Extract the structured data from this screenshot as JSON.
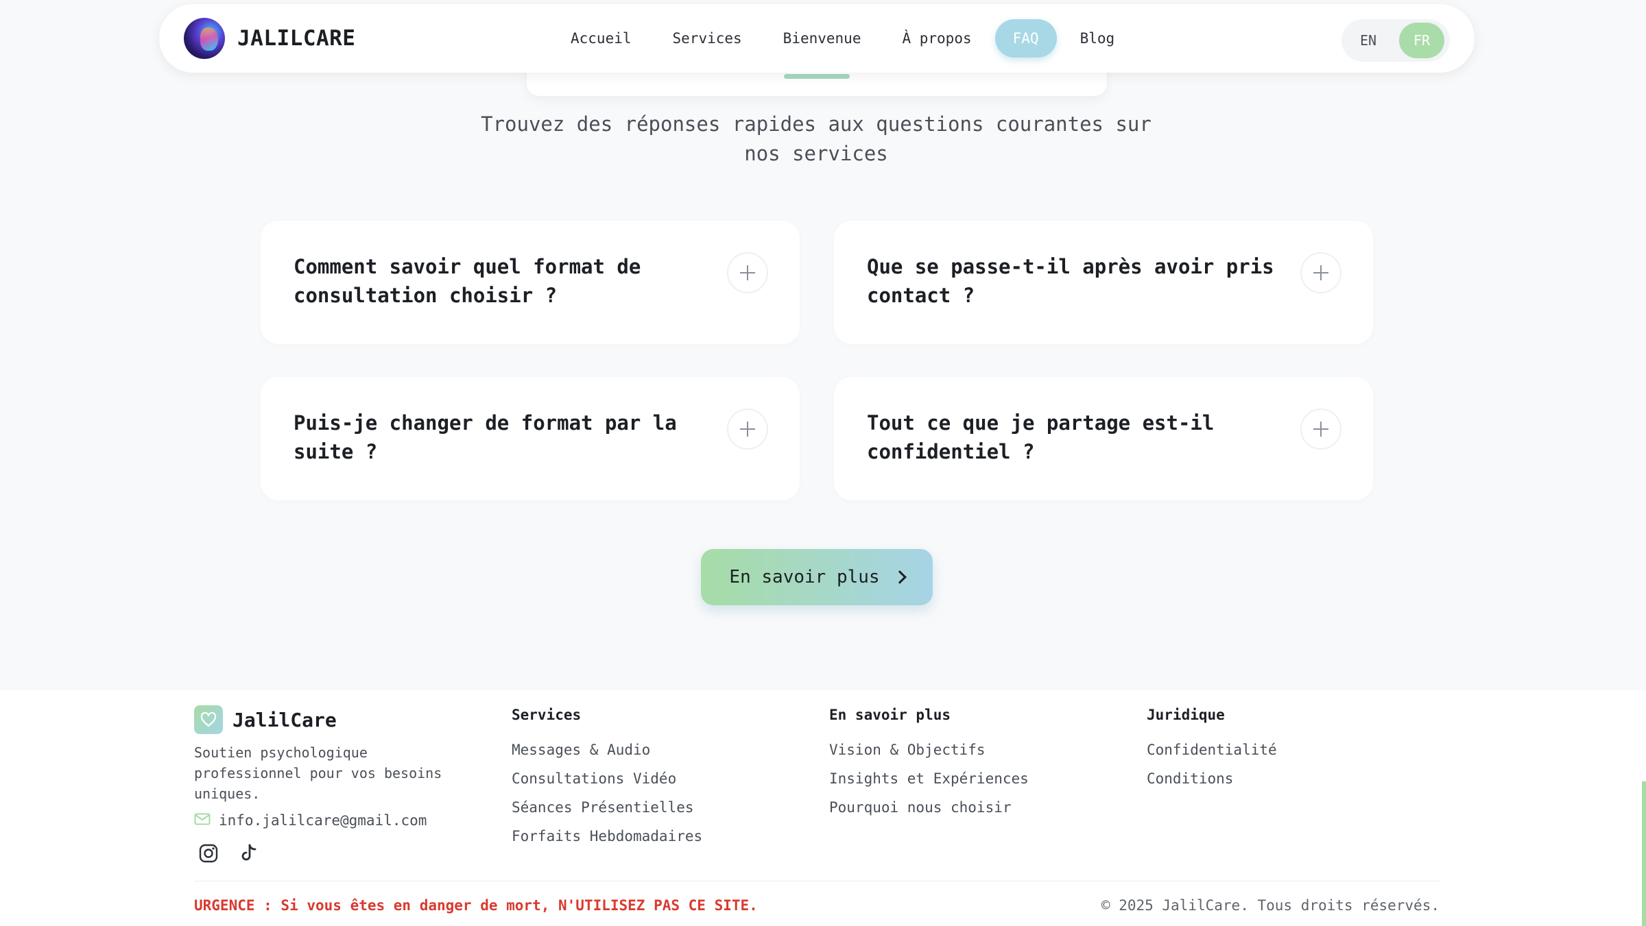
{
  "nav": {
    "brand": "JALILCARE",
    "links": [
      "Accueil",
      "Services",
      "Bienvenue",
      "À propos",
      "FAQ",
      "Blog"
    ],
    "active": "FAQ",
    "languages": [
      "EN",
      "FR"
    ],
    "active_language": "FR"
  },
  "faq": {
    "subtitle": "Trouvez des réponses rapides aux questions courantes sur nos services",
    "questions": [
      "Comment savoir quel format de consultation choisir ?",
      "Que se passe-t-il après avoir pris contact ?",
      "Puis-je changer de format par la suite ?",
      "Tout ce que je partage est-il confidentiel ?"
    ],
    "cta_label": "En savoir plus"
  },
  "footer": {
    "brand": "JalilCare",
    "description": "Soutien psychologique professionnel pour vos besoins uniques.",
    "email": "info.jalilcare@gmail.com",
    "social_icons": [
      "instagram-icon",
      "tiktok-icon"
    ],
    "columns": [
      {
        "title": "Services",
        "links": [
          "Messages & Audio",
          "Consultations Vidéo",
          "Séances Présentielles",
          "Forfaits Hebdomadaires"
        ]
      },
      {
        "title": "En savoir plus",
        "links": [
          "Vision & Objectifs",
          "Insights et Expériences",
          "Pourquoi nous choisir"
        ]
      },
      {
        "title": "Juridique",
        "links": [
          "Confidentialité",
          "Conditions"
        ]
      }
    ],
    "urgence": "URGENCE : Si vous êtes en danger de mort, N'UTILISEZ PAS CE SITE.",
    "copyright": "© 2025 JalilCare. Tous droits réservés."
  },
  "colors": {
    "accent_green": "#a6dca6",
    "accent_blue": "#a8d8e6",
    "urgent_red": "#d93a2f",
    "background": "#f8f9fb"
  }
}
